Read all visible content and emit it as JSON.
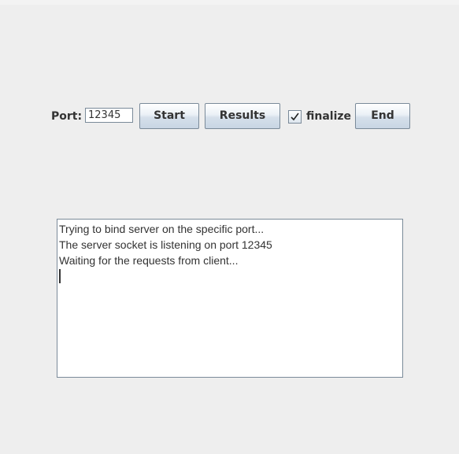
{
  "toolbar": {
    "port_label": "Port:",
    "port_value": "12345",
    "start_label": "Start",
    "results_label": "Results",
    "finalize_label": "finalize",
    "finalize_checked": true,
    "end_label": "End"
  },
  "log": {
    "lines": [
      "Trying to bind server on the specific port...",
      "The server socket is listening on port 12345",
      "Waiting for the requests from client..."
    ]
  },
  "colors": {
    "background": "#eeeeee",
    "border": "#7a8a99",
    "text": "#333333"
  }
}
